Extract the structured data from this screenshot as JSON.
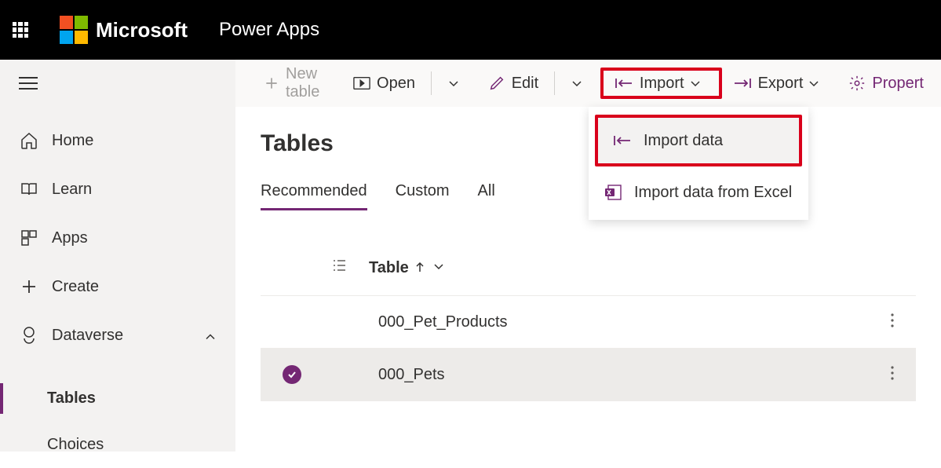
{
  "header": {
    "brand": "Microsoft",
    "app": "Power Apps"
  },
  "sidebar": {
    "items": [
      {
        "label": "Home"
      },
      {
        "label": "Learn"
      },
      {
        "label": "Apps"
      },
      {
        "label": "Create"
      },
      {
        "label": "Dataverse"
      }
    ],
    "sub": [
      {
        "label": "Tables"
      },
      {
        "label": "Choices"
      }
    ]
  },
  "toolbar": {
    "new_table": "New table",
    "open": "Open",
    "edit": "Edit",
    "import": "Import",
    "export": "Export",
    "properties": "Propert"
  },
  "dropdown": {
    "import_data": "Import data",
    "import_excel": "Import data from Excel"
  },
  "page": {
    "title": "Tables"
  },
  "tabs": [
    "Recommended",
    "Custom",
    "All"
  ],
  "table": {
    "header_label": "Table",
    "rows": [
      {
        "name": "000_Pet_Products",
        "selected": false
      },
      {
        "name": "000_Pets",
        "selected": true
      }
    ]
  }
}
